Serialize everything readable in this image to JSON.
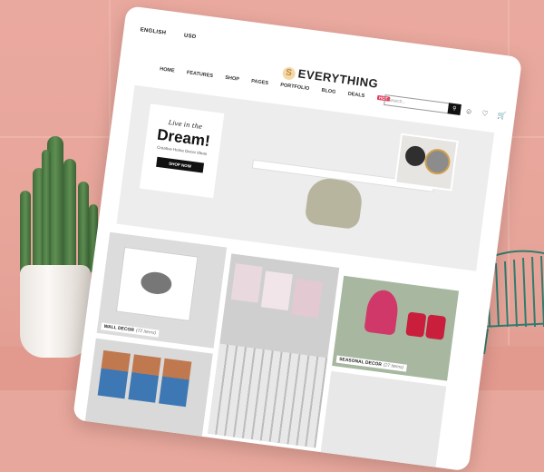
{
  "topbar": {
    "language": "ENGLISH",
    "currency": "USD"
  },
  "logo": {
    "mark": "S",
    "text": "EVERYTHING"
  },
  "nav": [
    "HOME",
    "FEATURES",
    "SHOP",
    "PAGES",
    "PORTFOLIO",
    "BLOG",
    "DEALS"
  ],
  "nav_badge": "HOT",
  "search": {
    "placeholder": "Search...",
    "go_icon": "search-icon"
  },
  "header_icons": [
    "user-icon",
    "heart-icon",
    "cart-icon"
  ],
  "hero": {
    "tagline": "Live in the",
    "headline": "Dream!",
    "subtext": "Creative Home Decor Ideas",
    "cta": "SHOP NOW"
  },
  "categories": [
    {
      "name": "WALL DECOR",
      "count": "(72 Items)"
    },
    {
      "name": "SEASONAL DECOR",
      "count": "(27 Items)"
    }
  ],
  "colors": {
    "background": "#e8a79c",
    "accent": "#e8365a",
    "tablet": "#ffffff"
  }
}
